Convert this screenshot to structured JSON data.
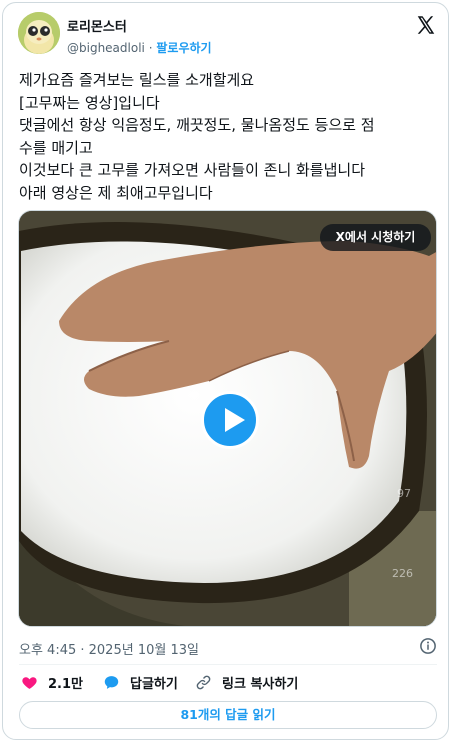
{
  "author": {
    "display_name": "로리몬스터",
    "handle": "@bigheadloli",
    "separator": "·",
    "follow_label": "팔로우하기"
  },
  "tweet": {
    "lines": [
      "제가요즘 즐겨보는 릴스를 소개할게요",
      "[고무짜는 영상]입니다",
      "댓글에선 항상 익음정도, 깨끗정도, 물나옴정도 등으로 점",
      "수를 매기고",
      "이것보다 큰 고무를 가져오면 사람들이 존니 화를냅니다",
      "아래 영상은 제 최애고무입니다"
    ]
  },
  "media": {
    "watch_label": "X에서 시청하기",
    "overlay_counts": [
      "97",
      "226"
    ]
  },
  "timestamp": "오후 4:45 · 2025년 10월 13일",
  "actions": {
    "like_count": "2.1만",
    "reply_label": "답글하기",
    "copy_link_label": "링크 복사하기"
  },
  "read_replies_label": "81개의 답글 읽기",
  "colors": {
    "accent": "#1d9bf0",
    "like": "#f91880",
    "muted": "#536471",
    "border": "#cfd9de"
  },
  "icons": [
    "x-logo-icon",
    "play-icon",
    "info-icon",
    "heart-icon",
    "reply-bubble-icon",
    "link-icon"
  ]
}
